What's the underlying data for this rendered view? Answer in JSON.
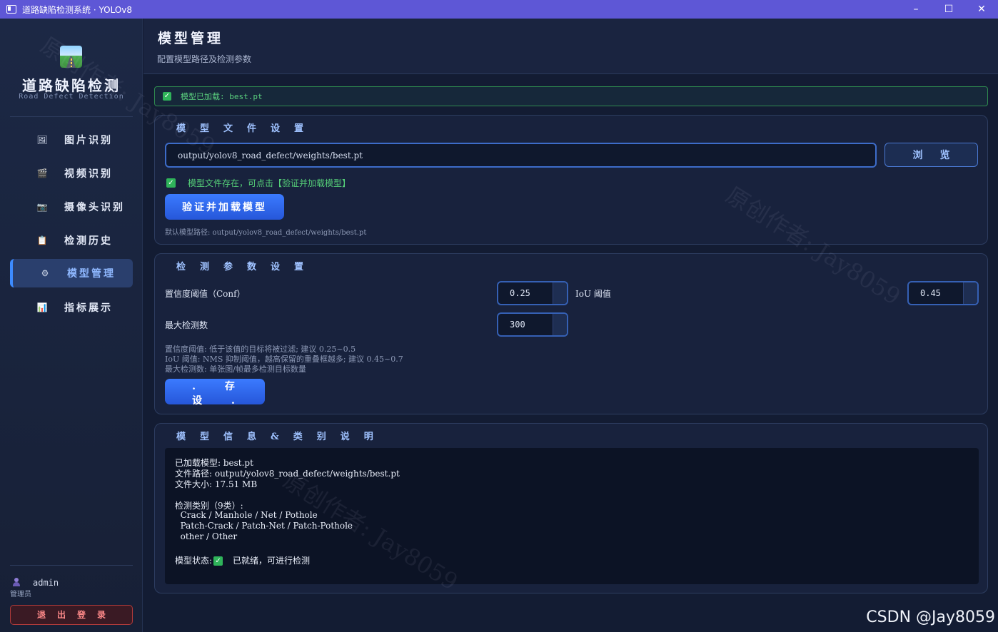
{
  "window": {
    "title": "道路缺陷检测系统 · YOLOv8",
    "controls": {
      "minimize": "–",
      "maximize": "☐",
      "close": "✕"
    }
  },
  "sidebar": {
    "app_title": "道路缺陷检测",
    "app_subtitle": "Road Defect Detection",
    "items": [
      {
        "label": "图片识别",
        "icon": "image-icon",
        "glyph": "🖼",
        "active": false
      },
      {
        "label": "视频识别",
        "icon": "video-icon",
        "glyph": "🎬",
        "active": false
      },
      {
        "label": "摄像头识别",
        "icon": "camera-icon",
        "glyph": "📷",
        "active": false
      },
      {
        "label": "检测历史",
        "icon": "history-icon",
        "glyph": "📋",
        "active": false
      },
      {
        "label": "模型管理",
        "icon": "gear-icon",
        "glyph": "⚙",
        "active": true
      },
      {
        "label": "指标展示",
        "icon": "chart-icon",
        "glyph": "📊",
        "active": false
      }
    ],
    "user": {
      "name": "admin",
      "role": "管理员"
    },
    "logout_label": "退出登录"
  },
  "header": {
    "title": "模型管理",
    "subtitle": "配置模型路径及检测参数"
  },
  "status_banner": {
    "text": "模型已加载: best.pt"
  },
  "model_file": {
    "title": "模型文件设置",
    "path_value": "output/yolov8_road_defect/weights/best.pt",
    "browse_label": "浏览",
    "exists_text": "模型文件存在，可点击【验证并加载模型】",
    "load_label": "验证并加载模型",
    "default_hint": "默认模型路径: output/yolov8_road_defect/weights/best.pt"
  },
  "params": {
    "title": "检测参数设置",
    "conf_label": "置信度阈值（Conf）",
    "conf_value": "0.25",
    "iou_label": "IoU 阈值",
    "iou_value": "0.45",
    "max_label": "最大检测数",
    "max_value": "300",
    "hint_lines": [
      "置信度阈值: 低于该值的目标将被过滤; 建议 0.25~0.5",
      "IoU 阈值: NMS 抑制阈值，越高保留的重叠框越多; 建议 0.45~0.7",
      "最大检测数: 单张图/帧最多检测目标数量"
    ],
    "save_label": ". 存 设 ."
  },
  "model_info": {
    "title": "模型信息&类别说明",
    "lines": [
      "已加载模型: best.pt",
      "文件路径: output/yolov8_road_defect/weights/best.pt",
      "文件大小: 17.51 MB",
      "检测类别（9类）:",
      "  Crack / Manhole / Net / Pothole",
      "  Patch-Crack / Patch-Net / Patch-Pothole",
      "  other / Other"
    ],
    "state_label": "模型状态:",
    "state_text": "已就绪，可进行检测"
  },
  "watermark": {
    "text_1": "原创作者: Jay8059",
    "text_2": "原创作者: Jay8059",
    "text_3": "原创作者: Jay8059",
    "csdn": "CSDN @Jay8059"
  },
  "colors": {
    "accent": "#3b7bff",
    "success": "#2fb45a",
    "titlebar": "#5e57d6",
    "danger": "#b03a3a"
  }
}
